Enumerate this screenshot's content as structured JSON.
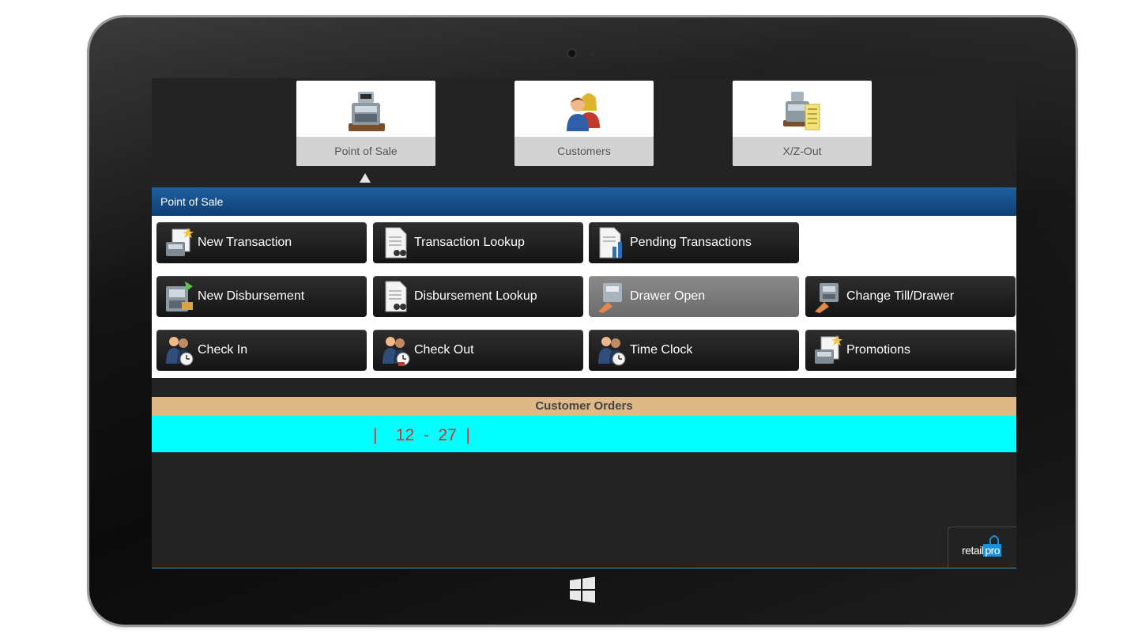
{
  "modules": [
    {
      "label": "Point of Sale",
      "icon": "cash-register-icon",
      "active": true
    },
    {
      "label": "Customers",
      "icon": "customers-icon",
      "active": false
    },
    {
      "label": "X/Z-Out",
      "icon": "cash-register-receipt-icon",
      "active": false
    }
  ],
  "section": {
    "title": "Point of Sale"
  },
  "actions": [
    {
      "label": "New Transaction",
      "icon": "new-transaction-icon",
      "enabled": true
    },
    {
      "label": "Transaction Lookup",
      "icon": "document-search-icon",
      "enabled": true
    },
    {
      "label": "Pending Transactions",
      "icon": "pending-documents-icon",
      "enabled": true
    },
    {
      "label": "New Disbursement",
      "icon": "new-disbursement-icon",
      "enabled": true
    },
    {
      "label": "Disbursement Lookup",
      "icon": "document-search-icon",
      "enabled": true
    },
    {
      "label": "Drawer Open",
      "icon": "drawer-open-icon",
      "enabled": false
    },
    {
      "label": "Change Till/Drawer",
      "icon": "change-drawer-icon",
      "enabled": true
    },
    {
      "label": "Check In",
      "icon": "clock-in-icon",
      "enabled": true
    },
    {
      "label": "Check Out",
      "icon": "clock-out-icon",
      "enabled": true
    },
    {
      "label": "Time Clock",
      "icon": "time-clock-icon",
      "enabled": true
    },
    {
      "label": "Promotions",
      "icon": "promotions-icon",
      "enabled": true
    }
  ],
  "customer_orders": {
    "title": "Customer Orders",
    "range_text": "|    12  -  27  |"
  },
  "logo": {
    "text_a": "retail",
    "text_b": "pro"
  },
  "colors": {
    "section_header": "#1e5fa0",
    "orders_header": "#deb887",
    "orders_row": "#00ffff",
    "orders_text": "#d23030",
    "logo_accent": "#1e90d6"
  }
}
